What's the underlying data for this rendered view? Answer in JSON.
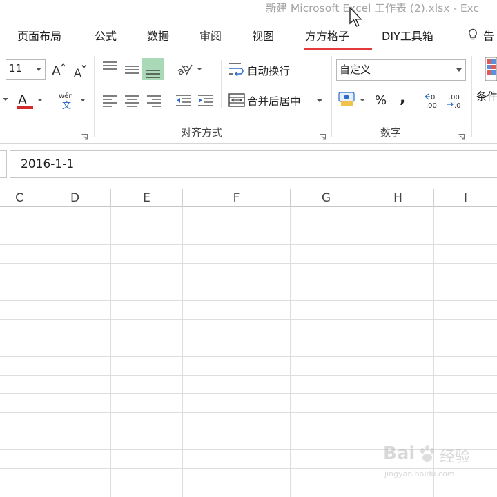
{
  "window": {
    "title": "新建 Microsoft Excel 工作表 (2).xlsx - Exc"
  },
  "ribbon_tabs": [
    {
      "label": "页面布局"
    },
    {
      "label": "公式"
    },
    {
      "label": "数据"
    },
    {
      "label": "审阅"
    },
    {
      "label": "视图"
    },
    {
      "label": "方方格子",
      "active": true
    },
    {
      "label": "DIY工具箱"
    },
    {
      "label": "告"
    }
  ],
  "font_group": {
    "font_size": "11"
  },
  "alignment_group": {
    "wrap_text_label": "自动换行",
    "merge_center_label": "合并后居中",
    "group_label": "对齐方式"
  },
  "number_group": {
    "format_value": "自定义",
    "percent_label": "%",
    "comma_label": ",",
    "group_label": "数字"
  },
  "styles_group": {
    "conditional_label": "条件"
  },
  "formula_bar": {
    "value": "2016-1-1"
  },
  "columns": [
    "C",
    "D",
    "E",
    "F",
    "G",
    "H",
    "I"
  ],
  "watermark": {
    "brand": "Bai",
    "brand2": "经验",
    "url": "jingyan.baidu.com"
  },
  "colors": {
    "accent_underline": "#e23a3a",
    "selected_align_bg": "#a9d9b6",
    "font_color_bar": "#d32b2b"
  }
}
